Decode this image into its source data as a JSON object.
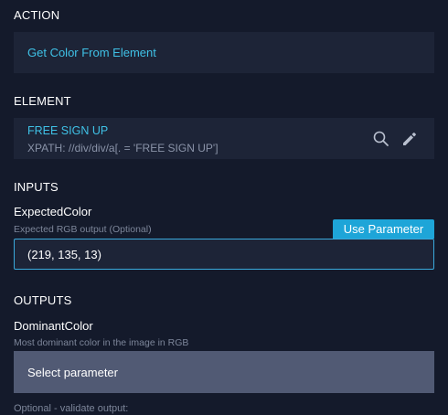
{
  "action": {
    "section_title": "ACTION",
    "value": "Get Color From Element"
  },
  "element": {
    "section_title": "ELEMENT",
    "name": "FREE SIGN UP",
    "xpath": "XPATH: //div/div/a[. = 'FREE SIGN UP']",
    "icons": [
      "search-icon",
      "pencil-icon"
    ]
  },
  "inputs": {
    "section_title": "INPUTS",
    "field_label": "ExpectedColor",
    "field_hint": "Expected RGB output (Optional)",
    "use_parameter_label": "Use Parameter",
    "value": "(219, 135, 13)"
  },
  "outputs": {
    "section_title": "OUTPUTS",
    "field_label": "DominantColor",
    "field_hint": "Most dominant color in the image in RGB",
    "select_label": "Select parameter",
    "footer_hint": "Optional - validate output:"
  },
  "colors": {
    "background": "#141a2b",
    "panel": "#1d2437",
    "accent": "#3fc1e6",
    "button": "#1ea5d8",
    "select": "#515a74"
  }
}
